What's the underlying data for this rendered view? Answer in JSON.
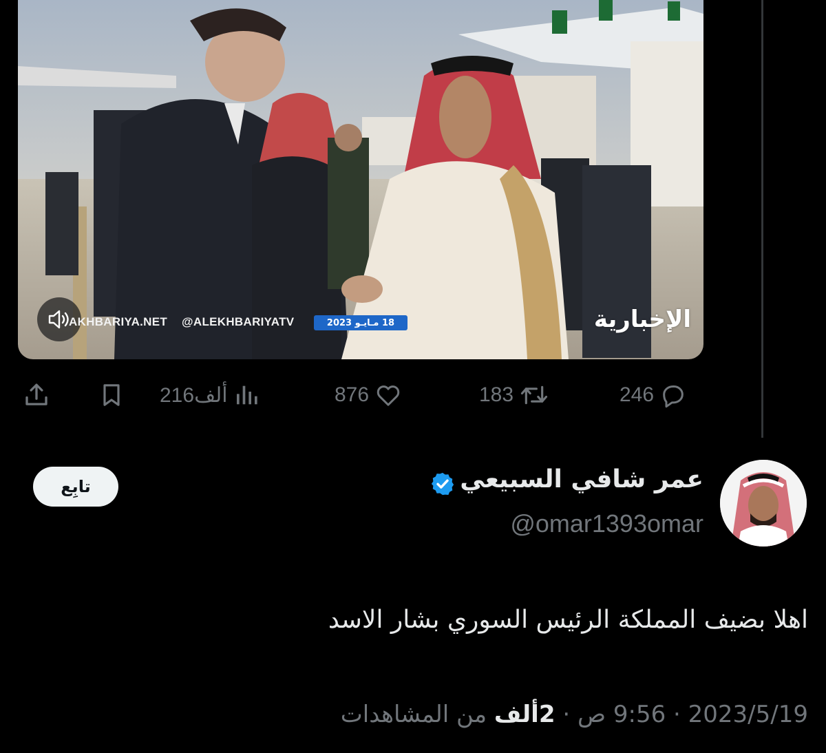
{
  "video": {
    "ticker_site": "AKHBARIYA.NET",
    "ticker_handle": "@ALEKHBARIYATV",
    "ticker_date": "18 مـايـو 2023",
    "channel_logo": "الإخبارية",
    "mute_icon": "speaker-muted-icon"
  },
  "actions": {
    "replies": "246",
    "reposts": "183",
    "likes": "876",
    "views": "216ألف",
    "reply_icon": "reply-icon",
    "repost_icon": "repost-icon",
    "like_icon": "heart-icon",
    "views_icon": "analytics-icon",
    "bookmark_icon": "bookmark-icon",
    "share_icon": "share-icon"
  },
  "tweet": {
    "display_name": "عمر شافي السبيعي",
    "handle": "@omar1393omar",
    "follow_label": "تابِع",
    "text": "اهلا بضيف المملكة الرئيس السوري بشار الاسد",
    "meta_date": "2023/5/19",
    "meta_time": "9:56 ص",
    "meta_views_count": "2ألف",
    "meta_views_label": "من المشاهدات",
    "separator": "·"
  },
  "colors": {
    "background": "#000000",
    "text_primary": "#e7e9ea",
    "text_secondary": "#71767b",
    "verified": "#1d9bf0",
    "follow_bg": "#eff3f4"
  }
}
